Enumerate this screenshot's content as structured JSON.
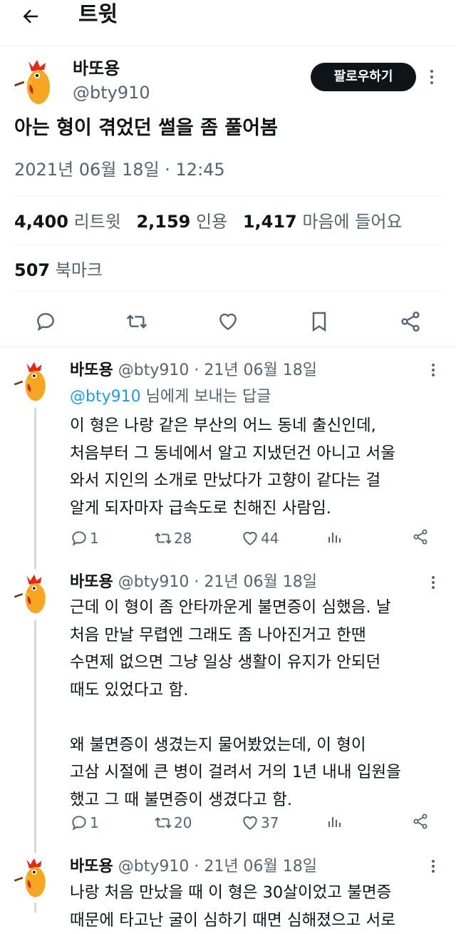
{
  "header": {
    "title": "트윗"
  },
  "tweet": {
    "author_name": "바또용",
    "author_handle": "@bty910",
    "follow_label": "팔로우하기",
    "text": "아는 형이 겪었던 썰을 좀 풀어봄",
    "timestamp": "2021년 06월 18일 · 12:45",
    "retweets": {
      "count": "4,400",
      "label": "리트윗"
    },
    "quotes": {
      "count": "2,159",
      "label": "인용"
    },
    "likes": {
      "count": "1,417",
      "label": "마음에 들어요"
    },
    "bookmarks": {
      "count": "507",
      "label": "북마크"
    }
  },
  "replies": [
    {
      "name": "바또용",
      "handle": "@bty910",
      "date": "· 21년 06월 18일",
      "reply_to_handle": "@bty910",
      "reply_to_suffix": " 님에게 보내는 답글",
      "text": "이 형은 나랑 같은 부산의 어느 동네 출신인데,\n처음부터 그 동네에서 알고 지냈던건 아니고 서울\n와서 지인의 소개로 만났다가 고향이 같다는 걸\n알게 되자마자 급속도로 친해진 사람임.",
      "reply_count": "1",
      "retweet_count": "28",
      "like_count": "44"
    },
    {
      "name": "바또용",
      "handle": "@bty910",
      "date": "· 21년 06월 18일",
      "text": "근데 이 형이 좀 안타까운게 불면증이 심했음. 날\n처음 만날 무렵엔 그래도 좀 나아진거고 한땐\n수면제 없으면 그냥 일상 생활이 유지가 안되던\n때도 있었다고 함.\n\n왜 불면증이 생겼는지 물어봤었는데, 이 형이\n고삼 시절에 큰 병이 걸려서 거의 1년 내내 입원을\n했고 그 때 불면증이 생겼다고 함.",
      "reply_count": "1",
      "retweet_count": "20",
      "like_count": "37"
    },
    {
      "name": "바또용",
      "handle": "@bty910",
      "date": "· 21년 06월 18일",
      "text": "나랑 처음 만났을 때 이 형은 30살이었고 불면증\n때문에 타고난 굴이 심하기 때면 심해졌으고 서로"
    }
  ],
  "colors": {
    "accent": "#1d9bf0",
    "text": "#0f1419",
    "muted": "#536471",
    "divider": "#eff3f4"
  }
}
